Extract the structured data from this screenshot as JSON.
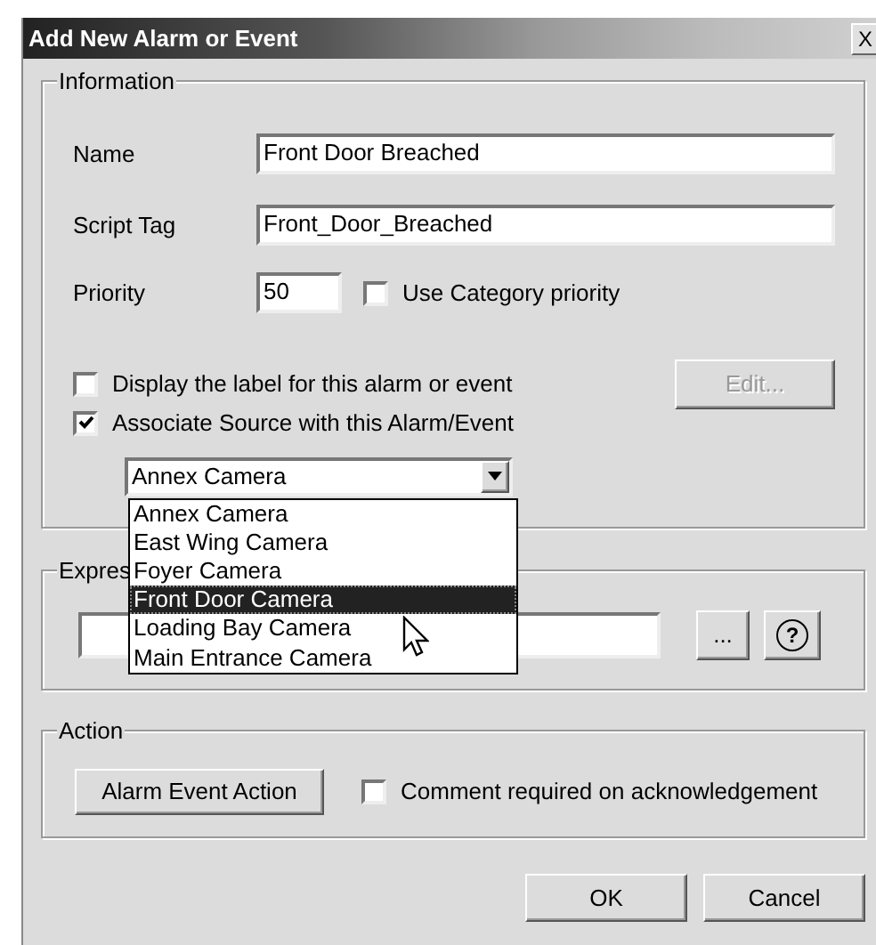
{
  "window": {
    "title": "Add New Alarm or Event",
    "close": "X"
  },
  "information": {
    "legend": "Information",
    "name": {
      "label": "Name",
      "value": "Front Door Breached"
    },
    "script_tag": {
      "label": "Script Tag",
      "value": "Front_Door_Breached"
    },
    "priority": {
      "label": "Priority",
      "value": "50"
    },
    "use_category_priority": {
      "label": "Use Category priority",
      "checked": false
    },
    "display_label": {
      "label": "Display the label for this alarm or event",
      "checked": false
    },
    "edit_button": {
      "label": "Edit...",
      "disabled": true
    },
    "associate_source": {
      "label": "Associate Source with this Alarm/Event",
      "checked": true
    },
    "source_select": {
      "value": "Annex Camera",
      "expanded": true,
      "options": [
        {
          "label": "Annex Camera",
          "highlighted": false
        },
        {
          "label": "East Wing Camera",
          "highlighted": false
        },
        {
          "label": "Foyer Camera",
          "highlighted": false
        },
        {
          "label": "Front Door Camera",
          "highlighted": true
        },
        {
          "label": "Loading Bay Camera",
          "highlighted": false
        },
        {
          "label": "Main Entrance Camera",
          "highlighted": false
        }
      ]
    }
  },
  "expression": {
    "legend": "Expres",
    "browse_button": "...",
    "help_button": "?"
  },
  "action": {
    "legend": "Action",
    "action_button": "Alarm Event Action",
    "comment_required": {
      "label": "Comment required on acknowledgement",
      "checked": false
    }
  },
  "buttons": [
    {
      "label": "OK"
    },
    {
      "label": "Cancel"
    }
  ]
}
